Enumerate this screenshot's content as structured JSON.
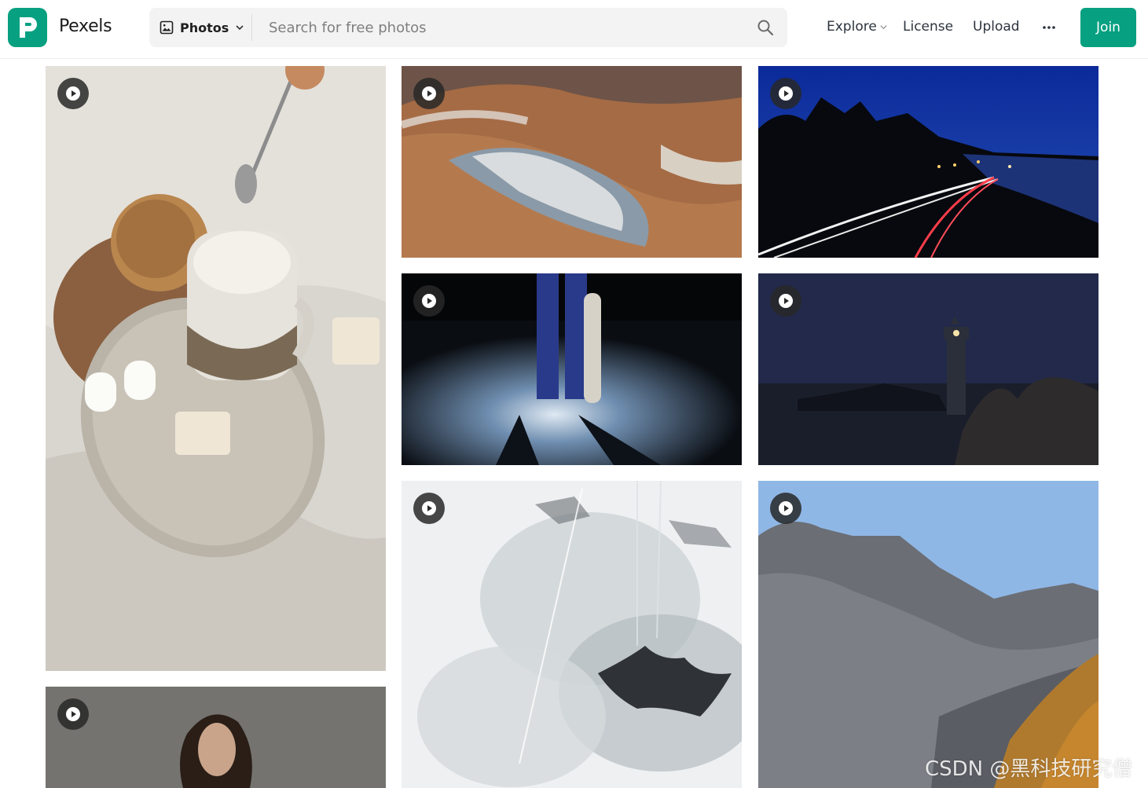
{
  "brand": {
    "name": "Pexels"
  },
  "search": {
    "media_type": "Photos",
    "placeholder": "Search for free photos"
  },
  "nav": {
    "explore": "Explore",
    "license": "License",
    "upload": "Upload",
    "join": "Join"
  },
  "icons": {
    "logo": "pexels-logo-icon",
    "media": "image-icon",
    "search": "search-icon",
    "more": "more-horizontal-icon",
    "play": "play-icon"
  },
  "colors": {
    "brand_green": "#07a081",
    "search_bg": "#f3f3f3"
  },
  "watermark": "CSDN @黑科技研究僧"
}
